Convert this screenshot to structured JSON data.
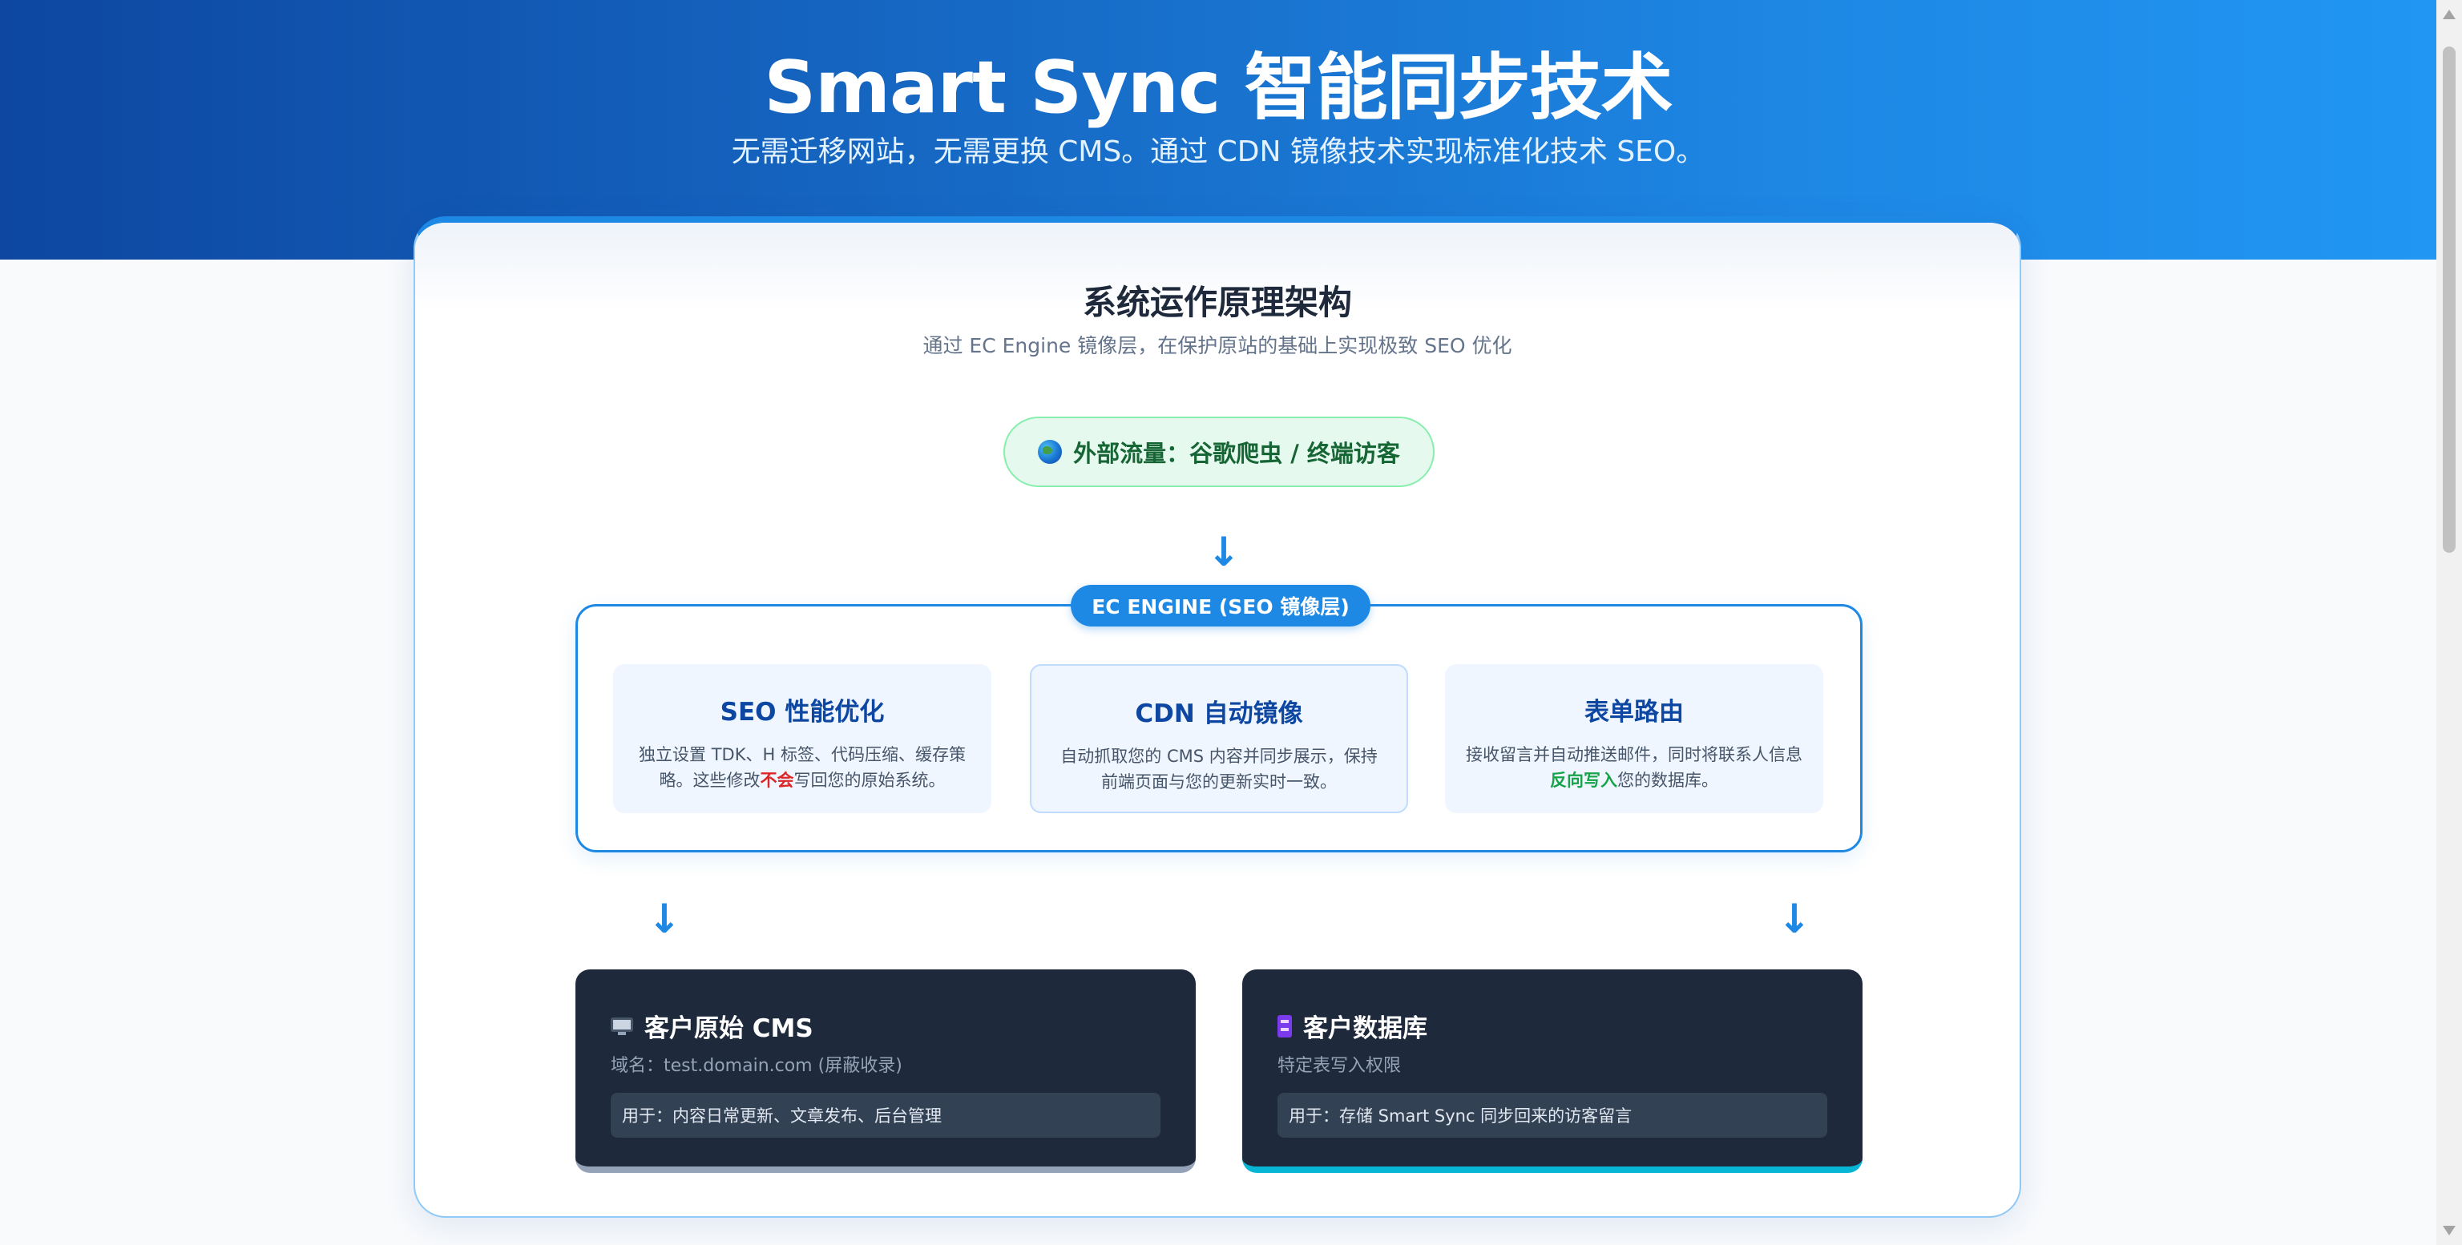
{
  "hero": {
    "title": "Smart Sync 智能同步技术",
    "subtitle": "无需迁移网站，无需更换 CMS。通过 CDN 镜像技术实现标准化技术 SEO。"
  },
  "architecture": {
    "title": "系统运作原理架构",
    "subtitle": "通过 EC Engine 镜像层，在保护原站的基础上实现极致 SEO 优化",
    "traffic": {
      "icon": "globe-icon",
      "label": "外部流量：谷歌爬虫 / 终端访客"
    },
    "arrow": "↓",
    "engine": {
      "badge": "EC ENGINE (SEO 镜像层)",
      "modules": [
        {
          "title": "SEO 性能优化",
          "desc_before": "独立设置 TDK、H 标签、代码压缩、缓存策略。这些修改",
          "desc_highlight": "不会",
          "desc_after": "写回您的原始系统。"
        },
        {
          "title": "CDN 自动镜像",
          "desc": "自动抓取您的 CMS 内容并同步展示，保持前端页面与您的更新实时一致。"
        },
        {
          "title": "表单路由",
          "desc_before": "接收留言并自动推送邮件，同时将联系人信息",
          "desc_highlight": "反向写入",
          "desc_after": "您的数据库。"
        }
      ]
    },
    "targets": [
      {
        "icon": "monitor-icon",
        "title": "客户原始 CMS",
        "subtitle": "域名：test.domain.com (屏蔽收录)",
        "usage": "用于：内容日常更新、文章发布、后台管理"
      },
      {
        "icon": "database-icon",
        "title": "客户数据库",
        "subtitle": "特定表写入权限",
        "usage": "用于：存储 Smart Sync 同步回来的访客留言"
      }
    ]
  },
  "colors": {
    "brand": "#1e88e5",
    "hero_dark": "#0d47a1",
    "traffic_bg": "#e6f9ee",
    "dark_card": "#1e293b",
    "accent_cyan": "#06b6d4",
    "warn_red": "#dc2626",
    "ok_green": "#16a34a"
  }
}
